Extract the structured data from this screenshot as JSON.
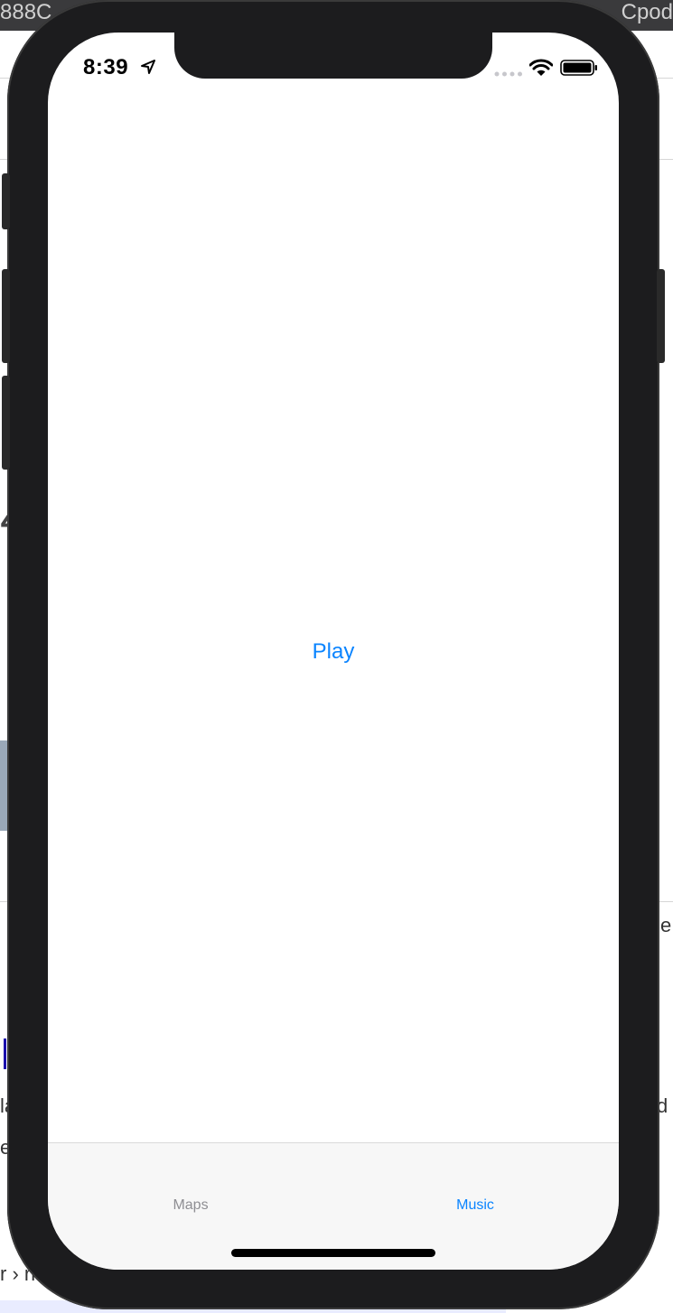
{
  "background_page": {
    "topbar_left": "888C",
    "topbar_right": "Cpod",
    "fragment_large": "4",
    "fragment_right_1": "e",
    "fragment_left_1": "la",
    "fragment_left_2": "e",
    "fragment_right_2": "d",
    "fragment_breadcrumb": "r › n"
  },
  "status_bar": {
    "time": "8:39",
    "location_icon": "location-arrow-icon",
    "signal_icon": "signal-dots-icon",
    "wifi_icon": "wifi-icon",
    "battery_icon": "battery-full-icon"
  },
  "main": {
    "play_label": "Play"
  },
  "tab_bar": {
    "tabs": [
      {
        "label": "Maps",
        "selected": false
      },
      {
        "label": "Music",
        "selected": true
      }
    ]
  },
  "colors": {
    "accent": "#0a84ff",
    "inactive_tab": "#8e8e93",
    "device_frame": "#1c1c1e"
  }
}
